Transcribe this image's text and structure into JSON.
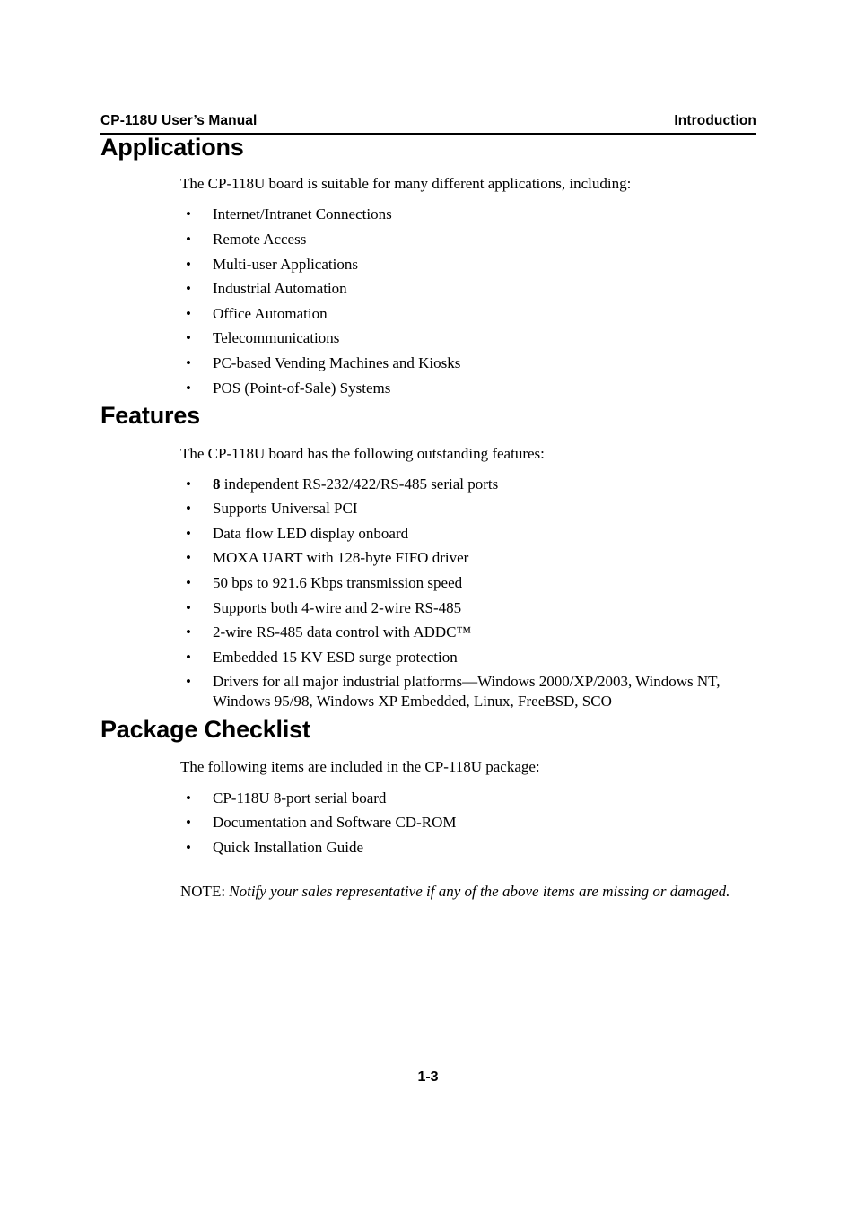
{
  "header": {
    "left": "CP-118U User’s Manual",
    "right": "Introduction"
  },
  "sections": {
    "applications": {
      "heading": "Applications",
      "intro": "The CP-118U board is suitable for many different applications, including:",
      "items": [
        "Internet/Intranet Connections",
        "Remote Access",
        "Multi-user Applications",
        "Industrial Automation",
        "Office Automation",
        "Telecommunications",
        "PC-based Vending Machines and Kiosks",
        "POS (Point-of-Sale) Systems"
      ]
    },
    "features": {
      "heading": "Features",
      "intro": "The CP-118U board has the following outstanding features:",
      "items": [
        {
          "bold_lead": "8",
          "text": " independent RS-232/422/RS-485 serial ports"
        },
        {
          "bold_lead": "",
          "text": "Supports Universal PCI"
        },
        {
          "bold_lead": "",
          "text": "Data flow LED display onboard"
        },
        {
          "bold_lead": "",
          "text": "MOXA UART with 128-byte FIFO driver"
        },
        {
          "bold_lead": "",
          "text": "50 bps to 921.6 Kbps transmission speed"
        },
        {
          "bold_lead": "",
          "text": "Supports both 4-wire and 2-wire RS-485"
        },
        {
          "bold_lead": "",
          "text": "2-wire RS-485 data control with ADDC™"
        },
        {
          "bold_lead": "",
          "text": "Embedded 15 KV ESD surge protection"
        },
        {
          "bold_lead": "",
          "text": "Drivers for all major industrial platforms—Windows 2000/XP/2003, Windows NT, Windows 95/98, Windows XP Embedded, Linux, FreeBSD, SCO"
        }
      ]
    },
    "package": {
      "heading": "Package Checklist",
      "intro": "The following items are included in the CP-118U package:",
      "items": [
        "CP-118U 8-port serial board",
        "Documentation and Software CD-ROM",
        "Quick Installation Guide"
      ],
      "note_label": "NOTE: ",
      "note_body": "Notify your sales representative if any of the above items are missing or damaged."
    }
  },
  "bullet_glyph": "•",
  "footer": {
    "page_number": "1-3"
  }
}
